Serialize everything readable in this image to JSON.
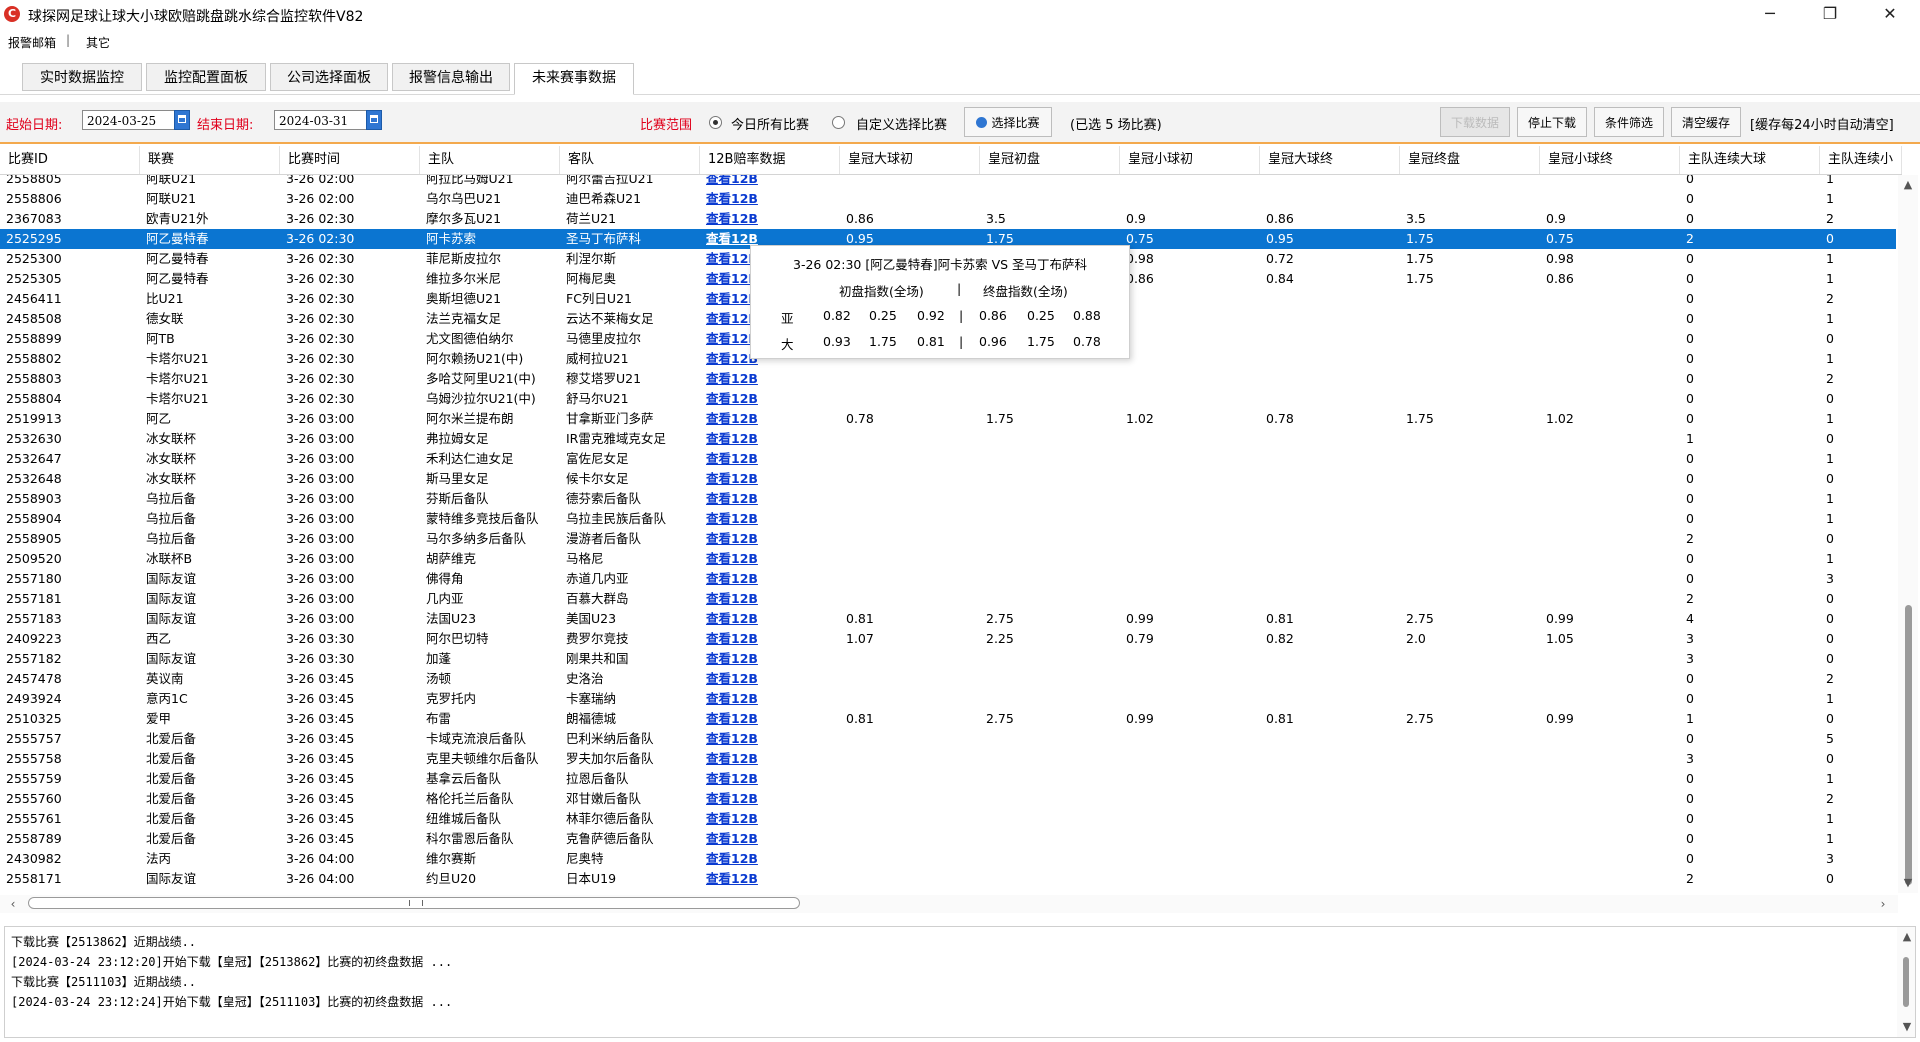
{
  "window": {
    "title": "球探网足球让球大小球欧赔跳盘跳水综合监控软件V82",
    "icon": "app-logo-icon",
    "buttons": {
      "minimize": "─",
      "maximize": "❐",
      "close": "✕"
    }
  },
  "menu": [
    "报警邮箱",
    "其它"
  ],
  "menu_separator": "|",
  "tabs": [
    {
      "label": "实时数据监控",
      "active": false
    },
    {
      "label": "监控配置面板",
      "active": false
    },
    {
      "label": "公司选择面板",
      "active": false
    },
    {
      "label": "报警信息输出",
      "active": false
    },
    {
      "label": "未来赛事数据",
      "active": true
    }
  ],
  "filter": {
    "start_label": "起始日期:",
    "start_date": "2024-03-25",
    "end_label": "结束日期:",
    "end_date": "2024-03-31",
    "range_label": "比赛范围",
    "radio_all": "今日所有比赛",
    "radio_custom": "自定义选择比赛",
    "select_button": "选择比赛",
    "selected_info": "(已选 5 场比赛)",
    "download_button": "下载数据",
    "stop_button": "停止下载",
    "filter_button": "条件筛选",
    "clear_button": "清空缓存",
    "cache_note": "[缓存每24小时自动清空]"
  },
  "columns": [
    "比赛ID",
    "联赛",
    "比赛时间",
    "主队",
    "客队",
    "12B赔率数据",
    "皇冠大球初",
    "皇冠初盘",
    "皇冠小球初",
    "皇冠大球终",
    "皇冠终盘",
    "皇冠小球终",
    "主队连续大球",
    "主队连续小"
  ],
  "link_text": "查看12B",
  "rows": [
    [
      "2558805",
      "阿联U21",
      "3-26 02:00",
      "阿拉比马姆U21",
      "阿尔蕾吉拉U21",
      "",
      "",
      "",
      "",
      "",
      "",
      "0",
      "1"
    ],
    [
      "2558806",
      "阿联U21",
      "3-26 02:00",
      "乌尔乌巴U21",
      "迪巴希森U21",
      "",
      "",
      "",
      "",
      "",
      "",
      "0",
      "1"
    ],
    [
      "2367083",
      "欧青U21外",
      "3-26 02:30",
      "摩尔多瓦U21",
      "荷兰U21",
      "0.86",
      "3.5",
      "0.9",
      "0.86",
      "3.5",
      "0.9",
      "0",
      "2"
    ],
    [
      "2525295",
      "阿乙曼特春",
      "3-26 02:30",
      "阿卡苏索",
      "圣马丁布萨科",
      "0.95",
      "1.75",
      "0.75",
      "0.95",
      "1.75",
      "0.75",
      "2",
      "0"
    ],
    [
      "2525300",
      "阿乙曼特春",
      "3-26 02:30",
      "菲尼斯皮拉尔",
      "利涅尔斯",
      "",
      "",
      "0.98",
      "0.72",
      "1.75",
      "0.98",
      "0",
      "1"
    ],
    [
      "2525305",
      "阿乙曼特春",
      "3-26 02:30",
      "维拉多尔米尼",
      "阿梅尼奥",
      "",
      "",
      "0.86",
      "0.84",
      "1.75",
      "0.86",
      "0",
      "1"
    ],
    [
      "2456411",
      "比U21",
      "3-26 02:30",
      "奥斯坦德U21",
      "FC列日U21",
      "",
      "",
      "",
      "",
      "",
      "",
      "0",
      "2"
    ],
    [
      "2458508",
      "德女联",
      "3-26 02:30",
      "法兰克福女足",
      "云达不莱梅女足",
      "",
      "",
      "",
      "",
      "",
      "",
      "0",
      "1"
    ],
    [
      "2558899",
      "阿TB",
      "3-26 02:30",
      "尤文图德伯纳尔",
      "马德里皮拉尔",
      "",
      "",
      "",
      "",
      "",
      "",
      "0",
      "0"
    ],
    [
      "2558802",
      "卡塔尔U21",
      "3-26 02:30",
      "阿尔赖扬U21(中)",
      "威柯拉U21",
      "",
      "",
      "",
      "",
      "",
      "",
      "0",
      "1"
    ],
    [
      "2558803",
      "卡塔尔U21",
      "3-26 02:30",
      "多哈艾阿里U21(中)",
      "穆艾塔罗U21",
      "",
      "",
      "",
      "",
      "",
      "",
      "0",
      "2"
    ],
    [
      "2558804",
      "卡塔尔U21",
      "3-26 02:30",
      "乌姆沙拉尔U21(中)",
      "舒马尔U21",
      "",
      "",
      "",
      "",
      "",
      "",
      "0",
      "0"
    ],
    [
      "2519913",
      "阿乙",
      "3-26 03:00",
      "阿尔米兰提布朗",
      "甘拿斯亚门多萨",
      "0.78",
      "1.75",
      "1.02",
      "0.78",
      "1.75",
      "1.02",
      "0",
      "1"
    ],
    [
      "2532630",
      "冰女联杯",
      "3-26 03:00",
      "弗拉姆女足",
      "IR雷克雅域克女足",
      "",
      "",
      "",
      "",
      "",
      "",
      "1",
      "0"
    ],
    [
      "2532647",
      "冰女联杯",
      "3-26 03:00",
      "禾利达仁迪女足",
      "富佐尼女足",
      "",
      "",
      "",
      "",
      "",
      "",
      "0",
      "1"
    ],
    [
      "2532648",
      "冰女联杯",
      "3-26 03:00",
      "斯马里女足",
      "候卡尔女足",
      "",
      "",
      "",
      "",
      "",
      "",
      "0",
      "0"
    ],
    [
      "2558903",
      "乌拉后备",
      "3-26 03:00",
      "芬斯后备队",
      "德芬索后备队",
      "",
      "",
      "",
      "",
      "",
      "",
      "0",
      "1"
    ],
    [
      "2558904",
      "乌拉后备",
      "3-26 03:00",
      "蒙特维多竞技后备队",
      "乌拉圭民族后备队",
      "",
      "",
      "",
      "",
      "",
      "",
      "0",
      "1"
    ],
    [
      "2558905",
      "乌拉后备",
      "3-26 03:00",
      "马尔多纳多后备队",
      "漫游者后备队",
      "",
      "",
      "",
      "",
      "",
      "",
      "2",
      "0"
    ],
    [
      "2509520",
      "冰联杯B",
      "3-26 03:00",
      "胡萨维克",
      "马格尼",
      "",
      "",
      "",
      "",
      "",
      "",
      "0",
      "1"
    ],
    [
      "2557180",
      "国际友谊",
      "3-26 03:00",
      "佛得角",
      "赤道几内亚",
      "",
      "",
      "",
      "",
      "",
      "",
      "0",
      "3"
    ],
    [
      "2557181",
      "国际友谊",
      "3-26 03:00",
      "几内亚",
      "百慕大群岛",
      "",
      "",
      "",
      "",
      "",
      "",
      "2",
      "0"
    ],
    [
      "2557183",
      "国际友谊",
      "3-26 03:00",
      "法国U23",
      "美国U23",
      "0.81",
      "2.75",
      "0.99",
      "0.81",
      "2.75",
      "0.99",
      "4",
      "0"
    ],
    [
      "2409223",
      "西乙",
      "3-26 03:30",
      "阿尔巴切特",
      "费罗尔竞技",
      "1.07",
      "2.25",
      "0.79",
      "0.82",
      "2.0",
      "1.05",
      "3",
      "0"
    ],
    [
      "2557182",
      "国际友谊",
      "3-26 03:30",
      "加蓬",
      "刚果共和国",
      "",
      "",
      "",
      "",
      "",
      "",
      "3",
      "0"
    ],
    [
      "2457478",
      "英议南",
      "3-26 03:45",
      "汤顿",
      "史洛治",
      "",
      "",
      "",
      "",
      "",
      "",
      "0",
      "2"
    ],
    [
      "2493924",
      "意丙1C",
      "3-26 03:45",
      "克罗托内",
      "卡塞瑞纳",
      "",
      "",
      "",
      "",
      "",
      "",
      "0",
      "1"
    ],
    [
      "2510325",
      "爱甲",
      "3-26 03:45",
      "布雷",
      "朗福德城",
      "0.81",
      "2.75",
      "0.99",
      "0.81",
      "2.75",
      "0.99",
      "1",
      "0"
    ],
    [
      "2555757",
      "北爱后备",
      "3-26 03:45",
      "卡域克流浪后备队",
      "巴利米纳后备队",
      "",
      "",
      "",
      "",
      "",
      "",
      "0",
      "5"
    ],
    [
      "2555758",
      "北爱后备",
      "3-26 03:45",
      "克里夫顿维尔后备队",
      "罗夫加尔后备队",
      "",
      "",
      "",
      "",
      "",
      "",
      "3",
      "0"
    ],
    [
      "2555759",
      "北爱后备",
      "3-26 03:45",
      "基拿云后备队",
      "拉恩后备队",
      "",
      "",
      "",
      "",
      "",
      "",
      "0",
      "1"
    ],
    [
      "2555760",
      "北爱后备",
      "3-26 03:45",
      "格伦托兰后备队",
      "邓甘嫩后备队",
      "",
      "",
      "",
      "",
      "",
      "",
      "0",
      "2"
    ],
    [
      "2555761",
      "北爱后备",
      "3-26 03:45",
      "纽维城后备队",
      "林菲尔德后备队",
      "",
      "",
      "",
      "",
      "",
      "",
      "0",
      "1"
    ],
    [
      "2558789",
      "北爱后备",
      "3-26 03:45",
      "科尔雷恩后备队",
      "克鲁萨德后备队",
      "",
      "",
      "",
      "",
      "",
      "",
      "0",
      "1"
    ],
    [
      "2430982",
      "法丙",
      "3-26 04:00",
      "维尔赛斯",
      "尼奥特",
      "",
      "",
      "",
      "",
      "",
      "",
      "0",
      "3"
    ],
    [
      "2558171",
      "国际友谊",
      "3-26 04:00",
      "约旦U20",
      "日本U19",
      "",
      "",
      "",
      "",
      "",
      "",
      "2",
      "0"
    ]
  ],
  "selected_row": 3,
  "tooltip": {
    "title": "3-26 02:30  [阿乙曼特春]阿卡苏索   VS   圣马丁布萨科",
    "head_initial": "初盘指数(全场)",
    "head_sep": "|",
    "head_final": "终盘指数(全场)",
    "rows": [
      {
        "label": "亚",
        "initial": [
          "0.82",
          "0.25",
          "0.92"
        ],
        "final": [
          "0.86",
          "0.25",
          "0.88"
        ]
      },
      {
        "label": "大",
        "initial": [
          "0.93",
          "1.75",
          "0.81"
        ],
        "final": [
          "0.96",
          "1.75",
          "0.78"
        ]
      }
    ]
  },
  "log": [
    "下载比赛【2513862】近期战绩..",
    "[2024-03-24 23:12:20]开始下载【皇冠】【2513862】比赛的初终盘数据 ...",
    "下载比赛【2511103】近期战绩..",
    "[2024-03-24 23:12:24]开始下载【皇冠】【2511103】比赛的初终盘数据 ..."
  ],
  "colors": {
    "accent": "#0b75d1",
    "alert_red": "#e0001b",
    "link": "#0b3bd1",
    "divider_orange": "#f3a94d"
  }
}
